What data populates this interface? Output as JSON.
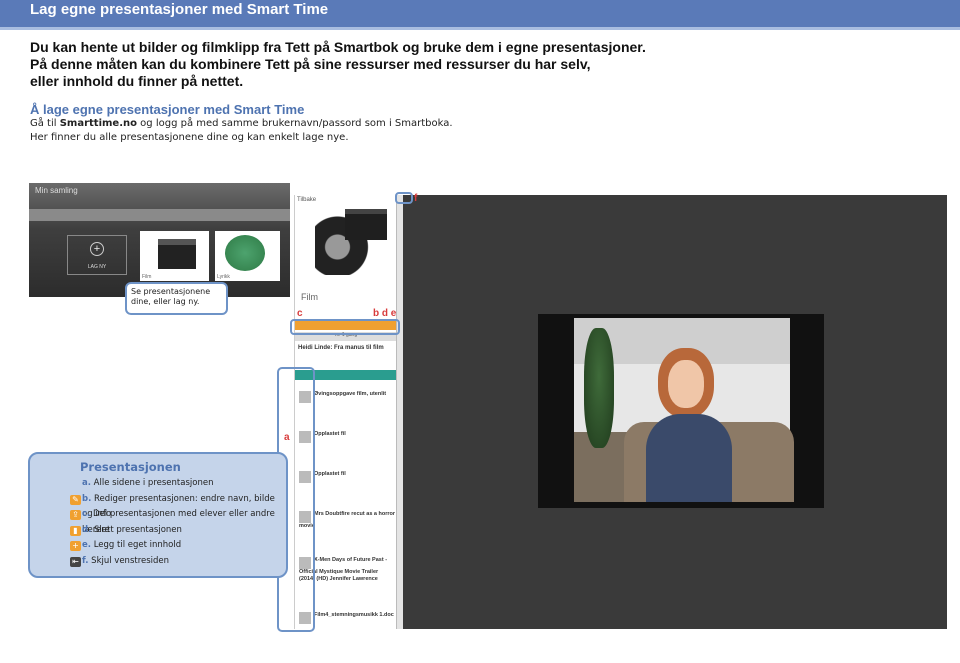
{
  "header": {
    "title": "Lag egne presentasjoner med Smart Time"
  },
  "intro": {
    "line1": "Du kan hente ut bilder og filmklipp fra Tett på Smartbok og bruke dem i egne presentasjoner.",
    "line2": "På denne måten kan du kombinere Tett på sine ressurser med ressurser du har selv,",
    "line3": "eller innhold du finner på nettet."
  },
  "section": {
    "heading": "Å lage egne presentasjoner med Smart Time",
    "line1_prefix": "Gå til ",
    "line1_link": "Smarttime.no",
    "line1_suffix": " og logg på med samme brukernavn/passord som i Smartboka.",
    "line2": "Her finner du alle presentasjonene dine og kan enkelt lage nye."
  },
  "screenshot1": {
    "title": "Min samling",
    "add_label": "LAG NY",
    "card1": "Film",
    "card2": "Lyrikk"
  },
  "callout1": {
    "text": "Se presentasjonene dine, eller lag ny."
  },
  "panel": {
    "back_label": "Tilbake",
    "film_label": "Film",
    "slide_count": "nr. 1 gang",
    "heidi": "Heidi Linde: Fra manus til film",
    "items": [
      "Øvingsoppgave film, utenlit",
      "Opplastet fil",
      "Opplastet fil",
      "Mrs Doubtfire recut as a horror movie",
      "X-Men Days of Future Past - Official Mystique Movie Trailer (2014) (HD) Jennifer Lawrence",
      "Film4_stemningsmusikk 1.doc"
    ]
  },
  "labels": {
    "a": "a",
    "c": "c",
    "bde": "b d e",
    "f": "f"
  },
  "legend": {
    "title": "Presentasjonen",
    "rows": [
      {
        "key": "a.",
        "text": " Alle sidene i presentasjonen",
        "icon": ""
      },
      {
        "key": "b.",
        "text": " Rediger presentasjonen: endre navn, bilde og info",
        "icon": "edit-icon"
      },
      {
        "key": "c.",
        "text": " Del presentasjonen med elever eller andre lærere",
        "icon": "share-icon"
      },
      {
        "key": "d.",
        "text": " Slett presentasjonen",
        "icon": "trash-icon"
      },
      {
        "key": "e.",
        "text": " Legg til eget innhold",
        "icon": "plus-icon"
      },
      {
        "key": "f.",
        "text": " Skjul venstresiden",
        "icon": "hide-sidebar-icon"
      }
    ]
  },
  "colors": {
    "accent": "#4e73b0",
    "orange": "#f0a030",
    "teal": "#2a9d8f"
  }
}
